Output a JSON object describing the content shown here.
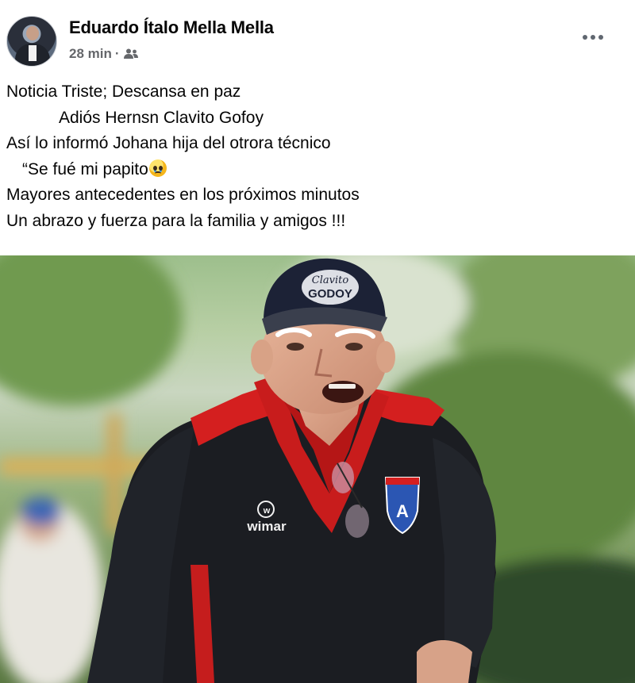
{
  "post": {
    "author": "Eduardo Ítalo Mella Mella",
    "time": "28 min",
    "separator": "·",
    "audience_icon": "friends-icon",
    "more_icon": "more-options-icon",
    "lines": [
      "Noticia Triste; Descansa en paz",
      "Adiós Hernsn Clavito Gofoy",
      "Así lo informó Johana hija del otrora técnico",
      "“Se fué mi papito",
      "Mayores antecedentes en los próximos minutos",
      "Un abrazo y fuerza para la familia y amigos !!!"
    ],
    "emoji": "crying-face-emoji"
  },
  "photo": {
    "cap_text_top": "Clavito",
    "cap_text_bottom": "GODOY",
    "shirt_brand": "wimar",
    "badge_letter": "A",
    "colors": {
      "jacket": "#1b1d22",
      "accent": "#d41f1f",
      "cap": "#1c2236"
    }
  }
}
